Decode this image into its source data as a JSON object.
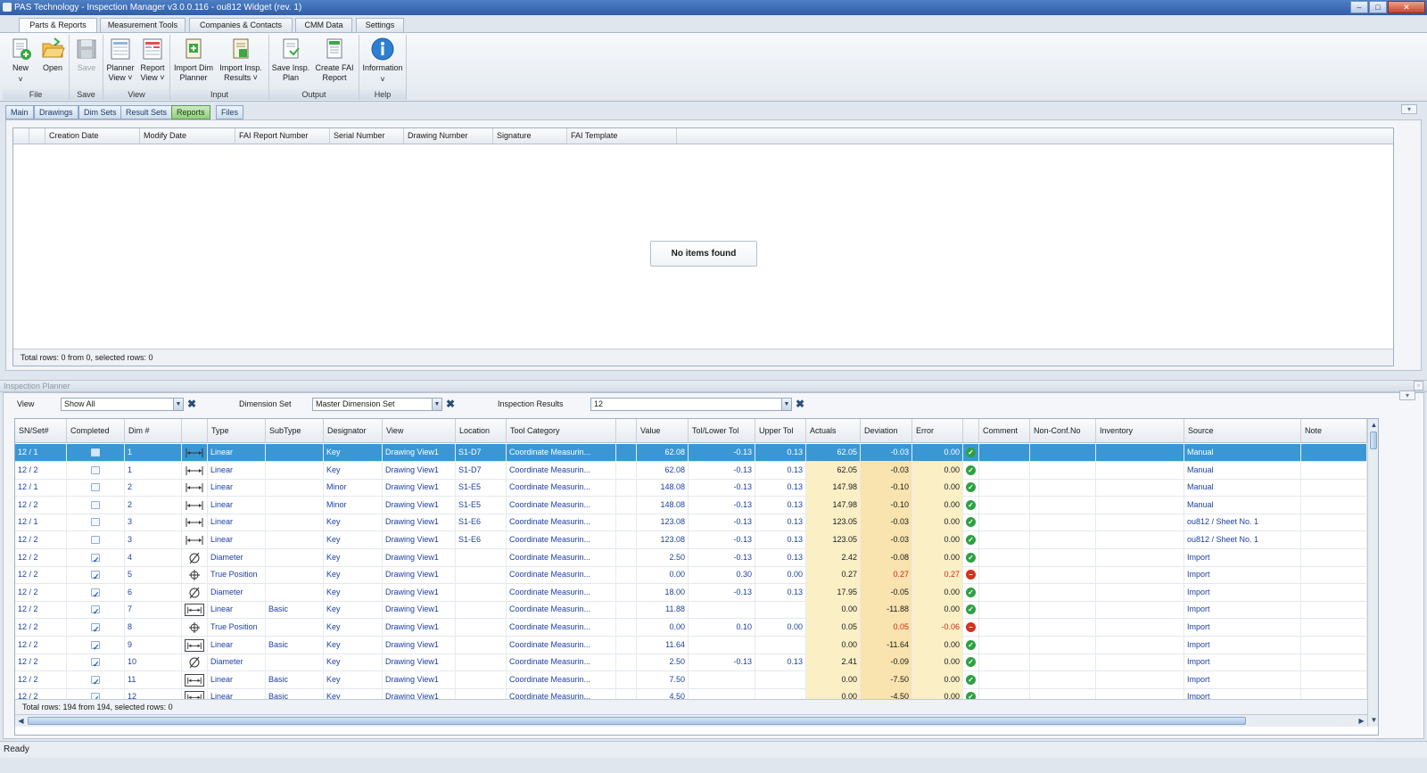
{
  "window": {
    "title": "PAS Technology - Inspection Manager v3.0.0.116 - ou812  Widget (rev. 1)",
    "min_icon": "minimize-icon",
    "max_icon": "maximize-icon",
    "close_icon": "close-icon"
  },
  "ribbon_tabs": [
    "Parts & Reports",
    "Measurement Tools",
    "Companies & Contacts",
    "CMM Data",
    "Settings"
  ],
  "ribbon": {
    "groups": {
      "file": "File",
      "save": "Save",
      "view": "View",
      "input": "Input",
      "output": "Output",
      "help": "Help"
    },
    "buttons": {
      "new": "New",
      "open": "Open",
      "save": "Save",
      "planner_view_1": "Planner",
      "planner_view_2": "View ˅",
      "report_view_1": "Report",
      "report_view_2": "View ˅",
      "import_dim_1": "Import Dim",
      "import_dim_2": "Planner",
      "import_insp_1": "Import Insp.",
      "import_insp_2": "Results ˅",
      "save_insp_1": "Save Insp.",
      "save_insp_2": "Plan",
      "create_fai_1": "Create FAI",
      "create_fai_2": "Report",
      "information": "Information"
    }
  },
  "sub_tabs": [
    "Main",
    "Drawings",
    "Dim Sets",
    "Result Sets",
    "Reports",
    "Files"
  ],
  "reports_grid": {
    "columns": [
      "Creation Date",
      "Modify Date",
      "FAI Report Number",
      "Serial Number",
      "Drawing Number",
      "Signature",
      "FAI Template"
    ],
    "empty_message": "No items found",
    "status": "Total rows: 0 from 0, selected rows: 0"
  },
  "planner": {
    "title": "Inspection Planner",
    "view_label": "View",
    "view_value": "Show All",
    "dimset_label": "Dimension Set",
    "dimset_value": "Master Dimension Set",
    "results_label": "Inspection Results",
    "results_value": "12",
    "columns": [
      "SN/Set#",
      "Completed",
      "Dim #",
      "",
      "Type",
      "SubType",
      "Designator",
      "View",
      "Location",
      "Tool Category",
      "",
      "Value",
      "Tol/Lower Tol",
      "Upper Tol",
      "Actuals",
      "Deviation",
      "Error",
      "",
      "Comment",
      "Non-Conf.No",
      "Inventory",
      "Source",
      "Note"
    ],
    "rows": [
      {
        "sn": "12 / 1",
        "done": false,
        "dim": "1",
        "icon": "linear-icon",
        "type": "Linear",
        "sub": "",
        "des": "Key",
        "view": "Drawing View1",
        "loc": "S1-D7",
        "tool": "Coordinate Measurin...",
        "val": "62.08",
        "lo": "-0.13",
        "up": "0.13",
        "act": "62.05",
        "dev": "-0.03",
        "err": "0.00",
        "ok": true,
        "src": "Manual",
        "selected": true
      },
      {
        "sn": "12 / 2",
        "done": false,
        "dim": "1",
        "icon": "linear-icon",
        "type": "Linear",
        "sub": "",
        "des": "Key",
        "view": "Drawing View1",
        "loc": "S1-D7",
        "tool": "Coordinate Measurin...",
        "val": "62.08",
        "lo": "-0.13",
        "up": "0.13",
        "act": "62.05",
        "dev": "-0.03",
        "err": "0.00",
        "ok": true,
        "src": "Manual"
      },
      {
        "sn": "12 / 1",
        "done": false,
        "dim": "2",
        "icon": "linear-icon",
        "type": "Linear",
        "sub": "",
        "des": "Minor",
        "view": "Drawing View1",
        "loc": "S1-E5",
        "tool": "Coordinate Measurin...",
        "val": "148.08",
        "lo": "-0.13",
        "up": "0.13",
        "act": "147.98",
        "dev": "-0.10",
        "err": "0.00",
        "ok": true,
        "src": "Manual"
      },
      {
        "sn": "12 / 2",
        "done": false,
        "dim": "2",
        "icon": "linear-icon",
        "type": "Linear",
        "sub": "",
        "des": "Minor",
        "view": "Drawing View1",
        "loc": "S1-E5",
        "tool": "Coordinate Measurin...",
        "val": "148.08",
        "lo": "-0.13",
        "up": "0.13",
        "act": "147.98",
        "dev": "-0.10",
        "err": "0.00",
        "ok": true,
        "src": "Manual"
      },
      {
        "sn": "12 / 1",
        "done": false,
        "dim": "3",
        "icon": "linear-icon",
        "type": "Linear",
        "sub": "",
        "des": "Key",
        "view": "Drawing View1",
        "loc": "S1-E6",
        "tool": "Coordinate Measurin...",
        "val": "123.08",
        "lo": "-0.13",
        "up": "0.13",
        "act": "123.05",
        "dev": "-0.03",
        "err": "0.00",
        "ok": true,
        "src": "ou812 / Sheet No. 1"
      },
      {
        "sn": "12 / 2",
        "done": false,
        "dim": "3",
        "icon": "linear-icon",
        "type": "Linear",
        "sub": "",
        "des": "Key",
        "view": "Drawing View1",
        "loc": "S1-E6",
        "tool": "Coordinate Measurin...",
        "val": "123.08",
        "lo": "-0.13",
        "up": "0.13",
        "act": "123.05",
        "dev": "-0.03",
        "err": "0.00",
        "ok": true,
        "src": "ou812 / Sheet No. 1"
      },
      {
        "sn": "12 / 2",
        "done": true,
        "dim": "4",
        "icon": "diameter-icon",
        "type": "Diameter",
        "sub": "",
        "des": "Key",
        "view": "Drawing View1",
        "loc": "",
        "tool": "Coordinate Measurin...",
        "val": "2.50",
        "lo": "-0.13",
        "up": "0.13",
        "act": "2.42",
        "dev": "-0.08",
        "err": "0.00",
        "ok": true,
        "src": "Import"
      },
      {
        "sn": "12 / 2",
        "done": true,
        "dim": "5",
        "icon": "true-position-icon",
        "type": "True Position",
        "sub": "",
        "des": "Key",
        "view": "Drawing View1",
        "loc": "",
        "tool": "Coordinate Measurin...",
        "val": "0.00",
        "lo": "0.30",
        "up": "0.00",
        "act": "0.27",
        "dev": "0.27",
        "err": "0.27",
        "ok": false,
        "src": "Import"
      },
      {
        "sn": "12 / 2",
        "done": true,
        "dim": "6",
        "icon": "diameter-icon",
        "type": "Diameter",
        "sub": "",
        "des": "Key",
        "view": "Drawing View1",
        "loc": "",
        "tool": "Coordinate Measurin...",
        "val": "18.00",
        "lo": "-0.13",
        "up": "0.13",
        "act": "17.95",
        "dev": "-0.05",
        "err": "0.00",
        "ok": true,
        "src": "Import"
      },
      {
        "sn": "12 / 2",
        "done": true,
        "dim": "7",
        "icon": "basic-linear-icon",
        "type": "Linear",
        "sub": "Basic",
        "des": "Key",
        "view": "Drawing View1",
        "loc": "",
        "tool": "Coordinate Measurin...",
        "val": "11.88",
        "lo": "",
        "up": "",
        "act": "0.00",
        "dev": "-11.88",
        "err": "0.00",
        "ok": true,
        "src": "Import"
      },
      {
        "sn": "12 / 2",
        "done": true,
        "dim": "8",
        "icon": "true-position-icon",
        "type": "True Position",
        "sub": "",
        "des": "Key",
        "view": "Drawing View1",
        "loc": "",
        "tool": "Coordinate Measurin...",
        "val": "0.00",
        "lo": "0.10",
        "up": "0.00",
        "act": "0.05",
        "dev": "0.05",
        "err": "-0.06",
        "ok": false,
        "src": "Import"
      },
      {
        "sn": "12 / 2",
        "done": true,
        "dim": "9",
        "icon": "basic-linear-icon",
        "type": "Linear",
        "sub": "Basic",
        "des": "Key",
        "view": "Drawing View1",
        "loc": "",
        "tool": "Coordinate Measurin...",
        "val": "11.64",
        "lo": "",
        "up": "",
        "act": "0.00",
        "dev": "-11.64",
        "err": "0.00",
        "ok": true,
        "src": "Import"
      },
      {
        "sn": "12 / 2",
        "done": true,
        "dim": "10",
        "icon": "diameter-icon",
        "type": "Diameter",
        "sub": "",
        "des": "Key",
        "view": "Drawing View1",
        "loc": "",
        "tool": "Coordinate Measurin...",
        "val": "2.50",
        "lo": "-0.13",
        "up": "0.13",
        "act": "2.41",
        "dev": "-0.09",
        "err": "0.00",
        "ok": true,
        "src": "Import"
      },
      {
        "sn": "12 / 2",
        "done": true,
        "dim": "11",
        "icon": "basic-linear-icon",
        "type": "Linear",
        "sub": "Basic",
        "des": "Key",
        "view": "Drawing View1",
        "loc": "",
        "tool": "Coordinate Measurin...",
        "val": "7.50",
        "lo": "",
        "up": "",
        "act": "0.00",
        "dev": "-7.50",
        "err": "0.00",
        "ok": true,
        "src": "Import"
      },
      {
        "sn": "12 / 2",
        "done": true,
        "dim": "12",
        "icon": "basic-linear-icon",
        "type": "Linear",
        "sub": "Basic",
        "des": "Key",
        "view": "Drawing View1",
        "loc": "",
        "tool": "Coordinate Measurin...",
        "val": "4.50",
        "lo": "",
        "up": "",
        "act": "0.00",
        "dev": "-4.50",
        "err": "0.00",
        "ok": true,
        "src": "Import"
      }
    ],
    "status": "Total rows: 194 from 194, selected rows: 0"
  },
  "statusbar": "Ready",
  "colors": {
    "selection": "#3a97d4",
    "ok": "#2ea043",
    "error": "#d0331f",
    "actual_bg": "#fbefc6",
    "active_subtab": "#8fcf7a"
  }
}
